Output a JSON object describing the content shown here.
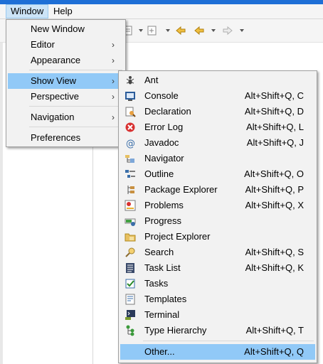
{
  "menubar": {
    "window": "Window",
    "help": "Help"
  },
  "window_menu": {
    "items": [
      {
        "label": "New Window"
      },
      {
        "label": "Editor"
      },
      {
        "label": "Appearance"
      },
      {
        "label": "Show View"
      },
      {
        "label": "Perspective"
      },
      {
        "label": "Navigation"
      },
      {
        "label": "Preferences"
      }
    ]
  },
  "showview_menu": {
    "items": [
      {
        "label": "Ant",
        "shortcut": "",
        "icon": "ant-icon"
      },
      {
        "label": "Console",
        "shortcut": "Alt+Shift+Q, C",
        "icon": "console-icon"
      },
      {
        "label": "Declaration",
        "shortcut": "Alt+Shift+Q, D",
        "icon": "declaration-icon"
      },
      {
        "label": "Error Log",
        "shortcut": "Alt+Shift+Q, L",
        "icon": "error-log-icon"
      },
      {
        "label": "Javadoc",
        "shortcut": "Alt+Shift+Q, J",
        "icon": "javadoc-icon"
      },
      {
        "label": "Navigator",
        "shortcut": "",
        "icon": "navigator-icon"
      },
      {
        "label": "Outline",
        "shortcut": "Alt+Shift+Q, O",
        "icon": "outline-icon"
      },
      {
        "label": "Package Explorer",
        "shortcut": "Alt+Shift+Q, P",
        "icon": "package-explorer-icon"
      },
      {
        "label": "Problems",
        "shortcut": "Alt+Shift+Q, X",
        "icon": "problems-icon"
      },
      {
        "label": "Progress",
        "shortcut": "",
        "icon": "progress-icon"
      },
      {
        "label": "Project Explorer",
        "shortcut": "",
        "icon": "project-explorer-icon"
      },
      {
        "label": "Search",
        "shortcut": "Alt+Shift+Q, S",
        "icon": "search-icon"
      },
      {
        "label": "Task List",
        "shortcut": "Alt+Shift+Q, K",
        "icon": "task-list-icon"
      },
      {
        "label": "Tasks",
        "shortcut": "",
        "icon": "tasks-icon"
      },
      {
        "label": "Templates",
        "shortcut": "",
        "icon": "templates-icon"
      },
      {
        "label": "Terminal",
        "shortcut": "",
        "icon": "terminal-icon"
      },
      {
        "label": "Type Hierarchy",
        "shortcut": "Alt+Shift+Q, T",
        "icon": "type-hierarchy-icon"
      },
      {
        "label": "Other...",
        "shortcut": "Alt+Shift+Q, Q",
        "icon": ""
      }
    ]
  }
}
